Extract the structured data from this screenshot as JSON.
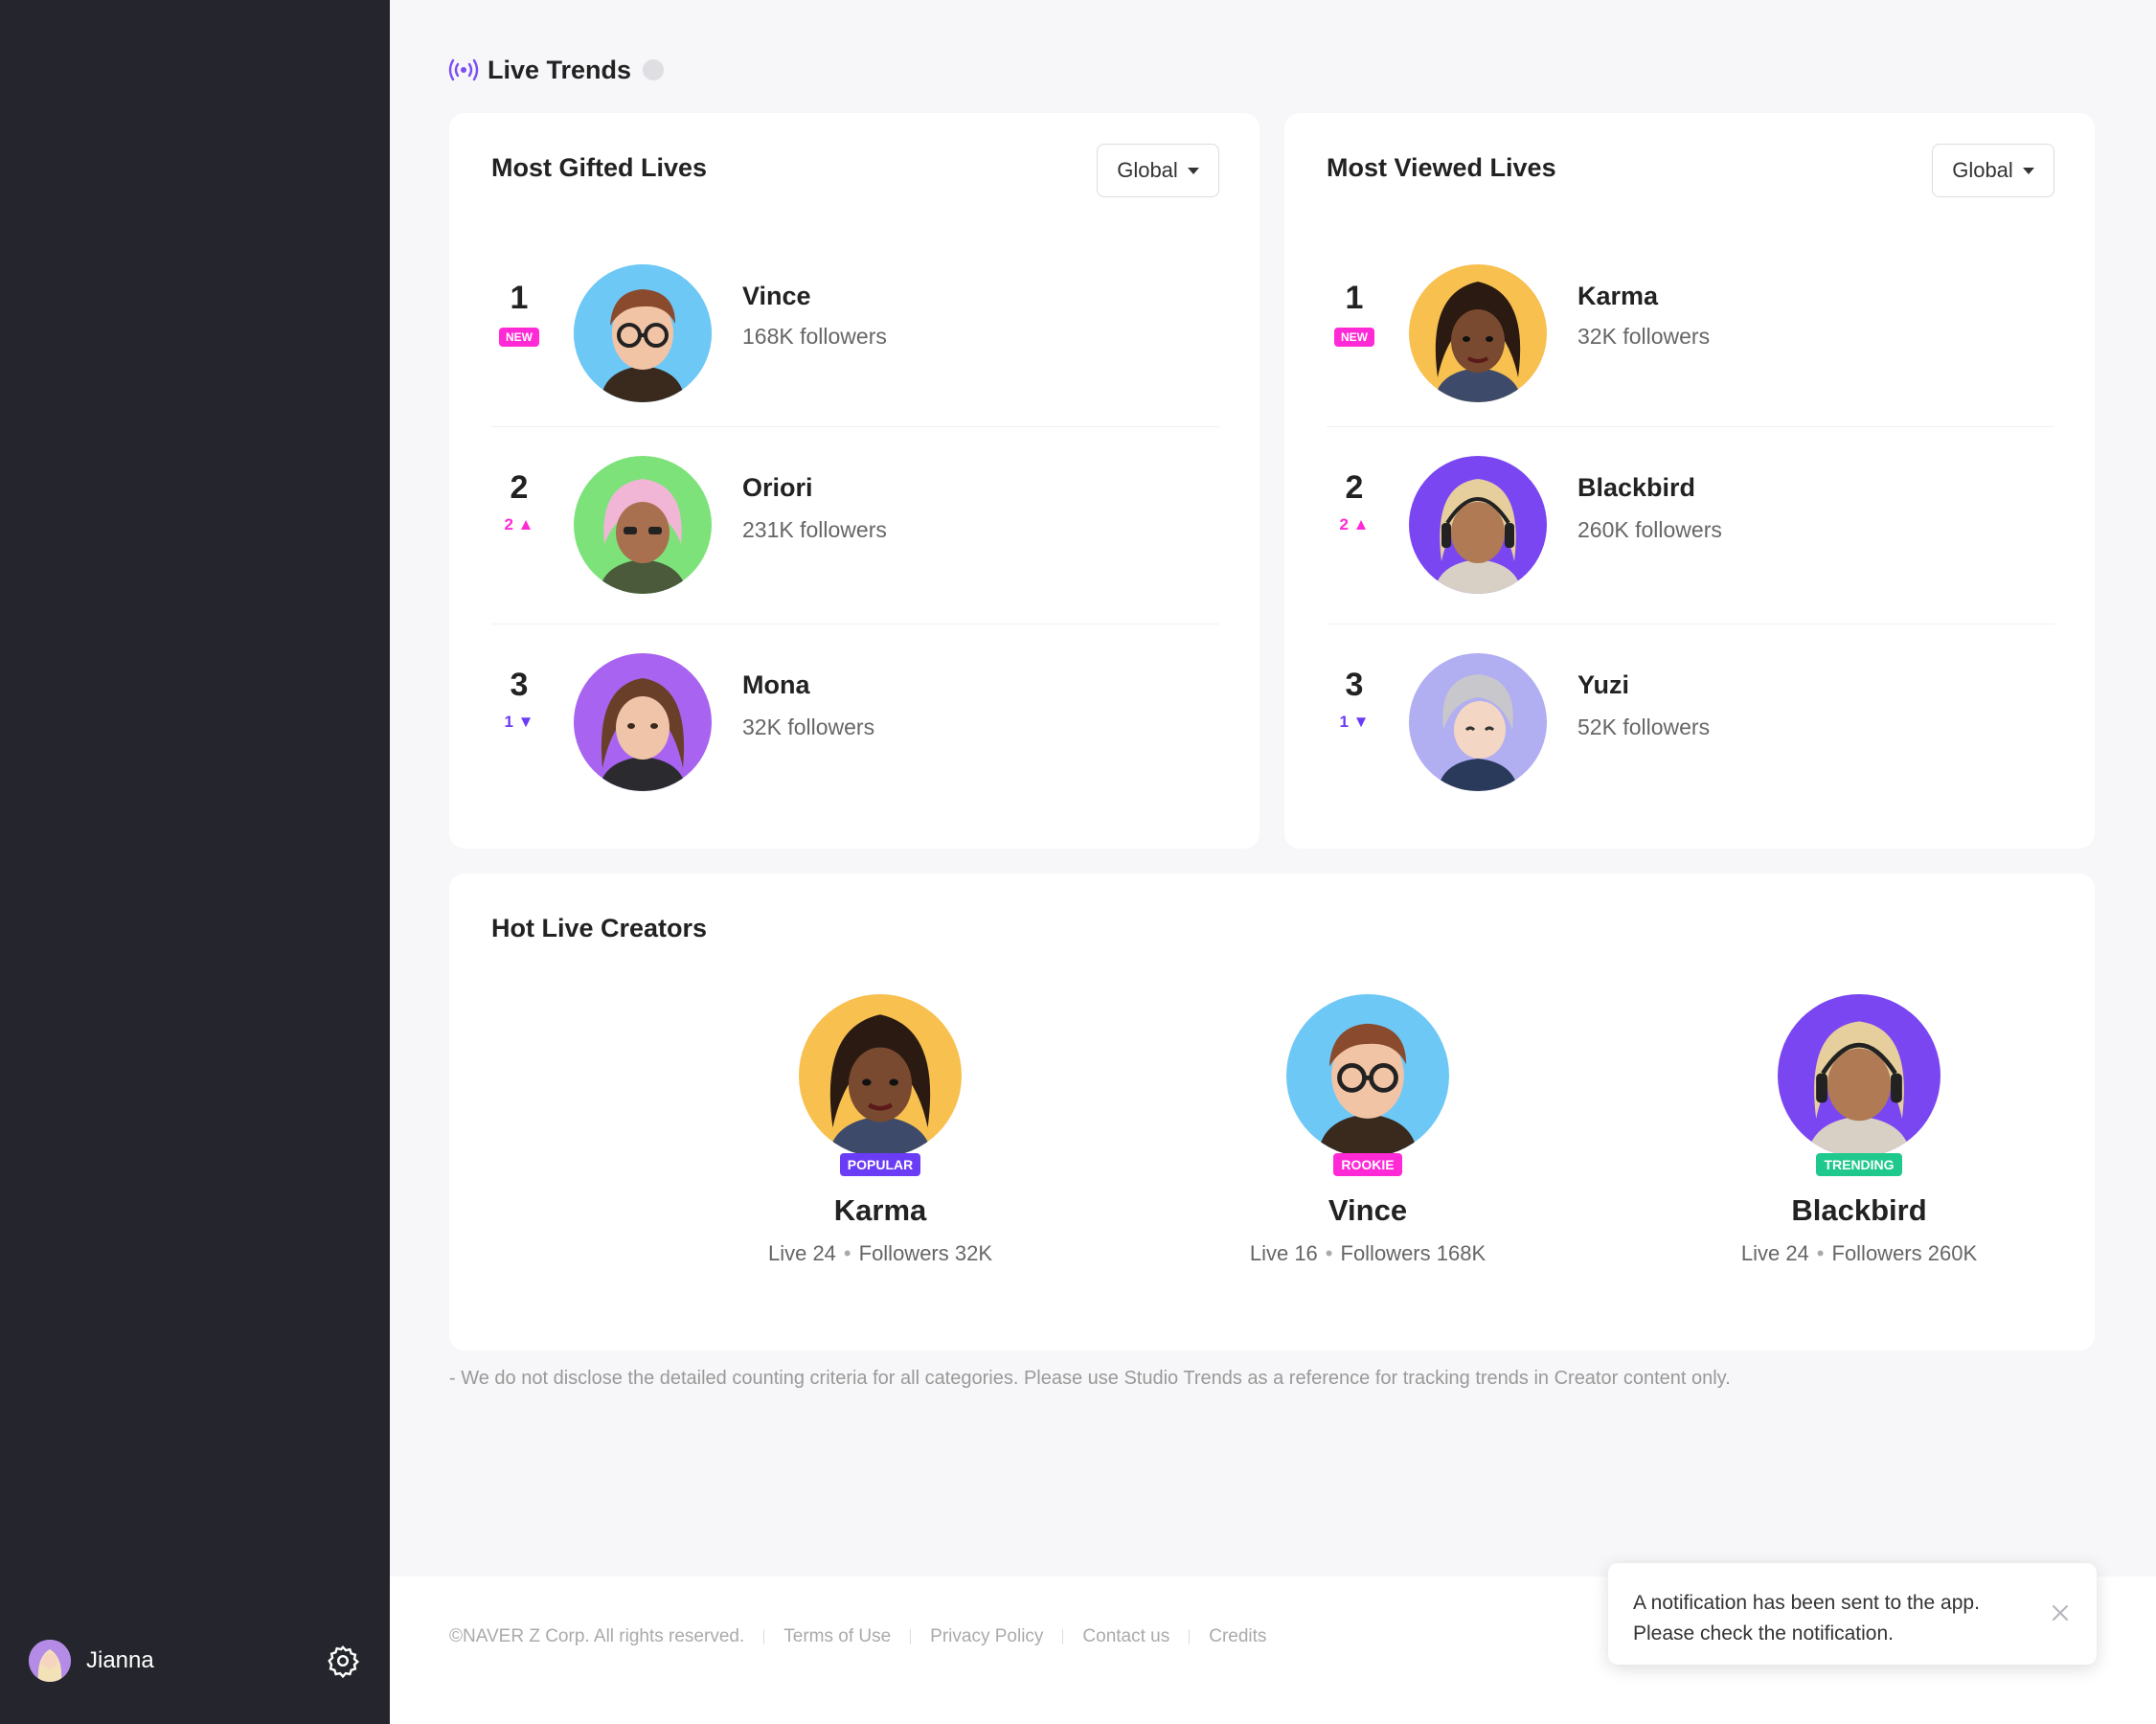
{
  "sidebar": {
    "user": {
      "name": "Jianna",
      "avatar_icon": "user-avatar"
    },
    "settings_icon": "gear-icon"
  },
  "header": {
    "title": "Live Trends",
    "icon": "live-broadcast-icon",
    "help_icon": "help-icon"
  },
  "most_gifted": {
    "title": "Most Gifted Lives",
    "filter": "Global",
    "rows": [
      {
        "rank": "1",
        "badge": "NEW",
        "name": "Vince",
        "followers": "168K followers",
        "avatar_bg": "#6ec8f5"
      },
      {
        "rank": "2",
        "change": "2",
        "direction": "up",
        "name": "Oriori",
        "followers": "231K followers",
        "avatar_bg": "#7de27a"
      },
      {
        "rank": "3",
        "change": "1",
        "direction": "down",
        "name": "Mona",
        "followers": "32K followers",
        "avatar_bg": "#a864f0"
      }
    ]
  },
  "most_viewed": {
    "title": "Most Viewed Lives",
    "filter": "Global",
    "rows": [
      {
        "rank": "1",
        "badge": "NEW",
        "name": "Karma",
        "followers": "32K followers",
        "avatar_bg": "#f7c04f"
      },
      {
        "rank": "2",
        "change": "2",
        "direction": "up",
        "name": "Blackbird",
        "followers": "260K followers",
        "avatar_bg": "#7a46f2"
      },
      {
        "rank": "3",
        "change": "1",
        "direction": "down",
        "name": "Yuzi",
        "followers": "52K followers",
        "avatar_bg": "#b1aef2"
      }
    ]
  },
  "hot_creators": {
    "title": "Hot Live Creators",
    "items": [
      {
        "name": "Karma",
        "tag": "POPULAR",
        "tag_color": "#6b3cf5",
        "live": "Live 24",
        "followers": "Followers 32K",
        "avatar_bg": "#f7c04f"
      },
      {
        "name": "Vince",
        "tag": "ROOKIE",
        "tag_color": "#ff2ad6",
        "live": "Live 16",
        "followers": "Followers 168K",
        "avatar_bg": "#6ec8f5"
      },
      {
        "name": "Blackbird",
        "tag": "TRENDING",
        "tag_color": "#1fc98d",
        "live": "Live 24",
        "followers": "Followers 260K",
        "avatar_bg": "#7a46f2"
      }
    ]
  },
  "disclaimer": "- We do not disclose the detailed counting criteria for all categories. Please use Studio Trends as a reference for tracking trends in Creator content only.",
  "footer": {
    "copyright": "©NAVER Z Corp. All rights reserved.",
    "links": [
      "Terms of Use",
      "Privacy Policy",
      "Contact us",
      "Credits"
    ]
  },
  "toast": {
    "line1": "A notification has been sent to the app.",
    "line2": "Please check the notification.",
    "close_icon": "close-icon"
  },
  "colors": {
    "accent": "#6b3cf5",
    "pink": "#ff2ad6",
    "sidebar_bg": "#25262d"
  }
}
